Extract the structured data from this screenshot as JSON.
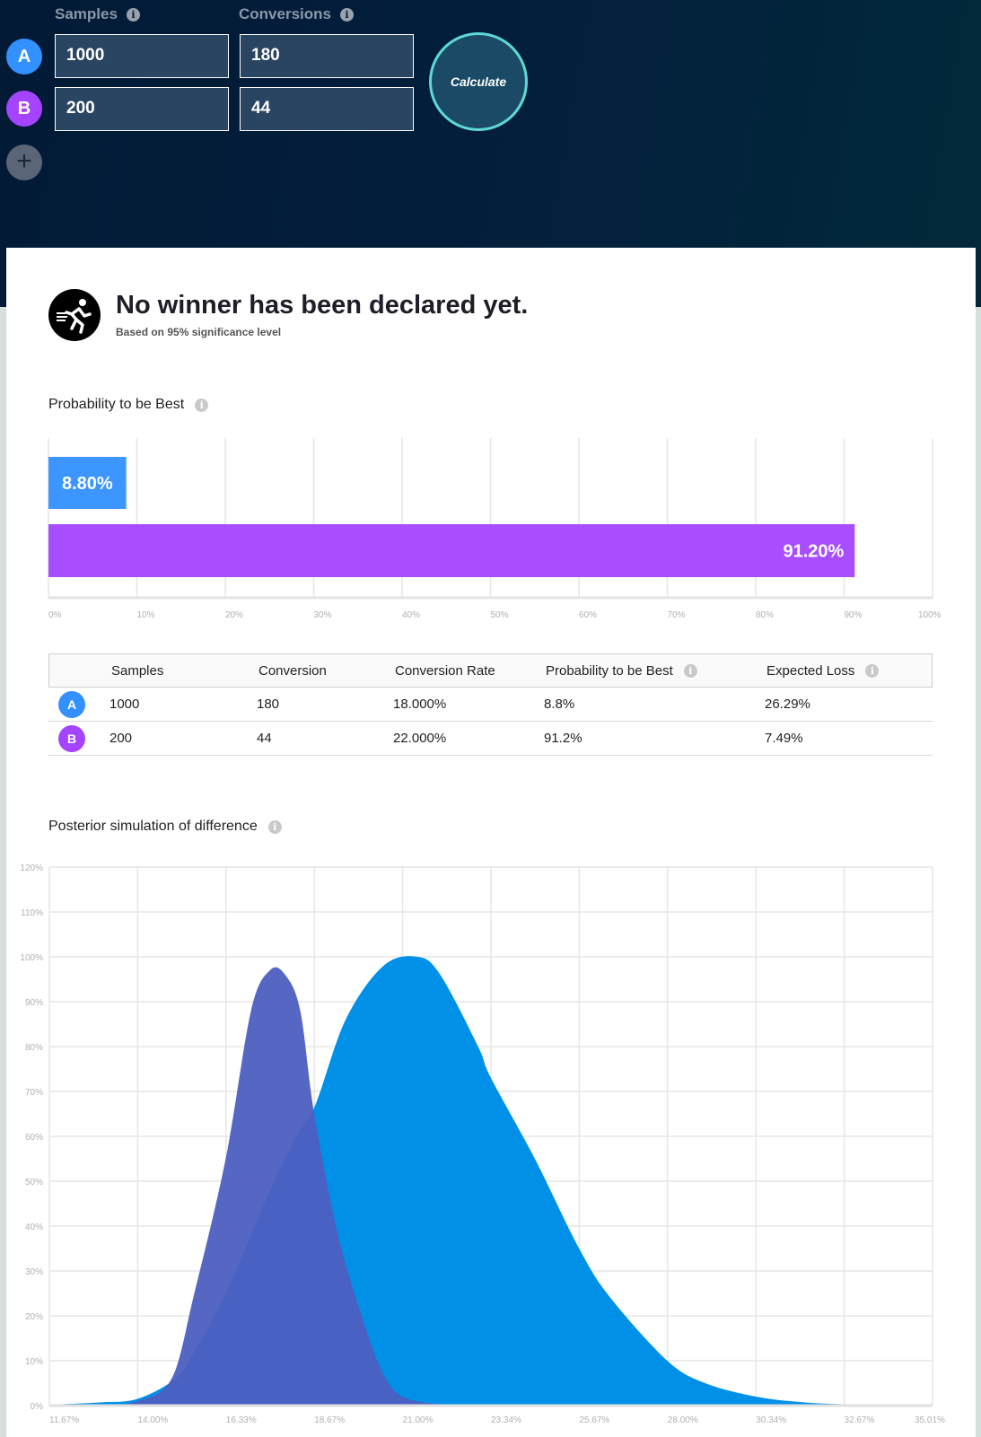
{
  "inputs": {
    "samples_label": "Samples",
    "conversions_label": "Conversions",
    "info_glyph": "i",
    "variants": [
      {
        "letter": "A",
        "samples": "1000",
        "conversions": "180",
        "color": "#3390ff"
      },
      {
        "letter": "B",
        "samples": "200",
        "conversions": "44",
        "color": "#a444ff"
      }
    ],
    "add_glyph": "+",
    "calculate_label": "Calculate"
  },
  "result": {
    "title": "No winner has been declared yet.",
    "subtitle": "Based on 95% significance level"
  },
  "prob_section": {
    "title": "Probability to be Best"
  },
  "table": {
    "headers": [
      "Samples",
      "Conversion",
      "Conversion Rate",
      "Probability to be Best",
      "Expected Loss"
    ],
    "rows": [
      {
        "letter": "A",
        "cells": [
          "1000",
          "180",
          "18.000%",
          "8.8%",
          "26.29%"
        ]
      },
      {
        "letter": "B",
        "cells": [
          "200",
          "44",
          "22.000%",
          "91.2%",
          "7.49%"
        ]
      }
    ]
  },
  "posterior_section": {
    "title": "Posterior simulation of difference"
  },
  "chart_data": [
    {
      "type": "bar",
      "orientation": "horizontal",
      "categories": [
        "A",
        "B"
      ],
      "values": [
        8.8,
        91.2
      ],
      "labels": [
        "8.80%",
        "91.20%"
      ],
      "colors": [
        "#3390ff",
        "#a444ff"
      ],
      "xlim": [
        0,
        100
      ],
      "xticks": [
        "0%",
        "10%",
        "20%",
        "30%",
        "40%",
        "50%",
        "60%",
        "70%",
        "80%",
        "90%",
        "100%"
      ],
      "grid": true
    },
    {
      "type": "area",
      "ylim": [
        0,
        120
      ],
      "xlim": [
        11.67,
        35.01
      ],
      "yticks": [
        "0%",
        "10%",
        "20%",
        "30%",
        "40%",
        "50%",
        "60%",
        "70%",
        "80%",
        "90%",
        "100%",
        "110%",
        "120%"
      ],
      "xticks": [
        "11.67%",
        "14.00%",
        "16.33%",
        "18.67%",
        "21.00%",
        "23.34%",
        "25.67%",
        "28.00%",
        "30.34%",
        "32.67%",
        "35.01%"
      ],
      "series": [
        {
          "name": "B",
          "color": "#0090e8",
          "x": [
            11.67,
            13,
            14,
            15,
            15.5,
            16.33,
            17.5,
            18.2,
            18.7,
            19.5,
            20.5,
            21.4,
            22,
            23,
            23.34,
            24.5,
            25.67,
            26.5,
            28,
            29,
            30.34,
            31.5,
            32.67,
            35.01
          ],
          "y": [
            0.2,
            0.7,
            1.5,
            6,
            12,
            25,
            48,
            60,
            67,
            86,
            98,
            100,
            96,
            80,
            73,
            55,
            35,
            24,
            10,
            5,
            2,
            0.8,
            0.3,
            0
          ]
        },
        {
          "name": "A",
          "color": "#4d5fc0",
          "x": [
            11.67,
            13,
            14,
            14.9,
            15.5,
            16.33,
            17,
            17.5,
            17.9,
            18.3,
            18.67,
            19.3,
            20,
            20.5,
            21,
            22,
            23
          ],
          "y": [
            0,
            0.2,
            1,
            6,
            25,
            55,
            88,
            97,
            96,
            88,
            65,
            38,
            18,
            7,
            2,
            0.3,
            0
          ]
        }
      ],
      "grid": true
    }
  ]
}
